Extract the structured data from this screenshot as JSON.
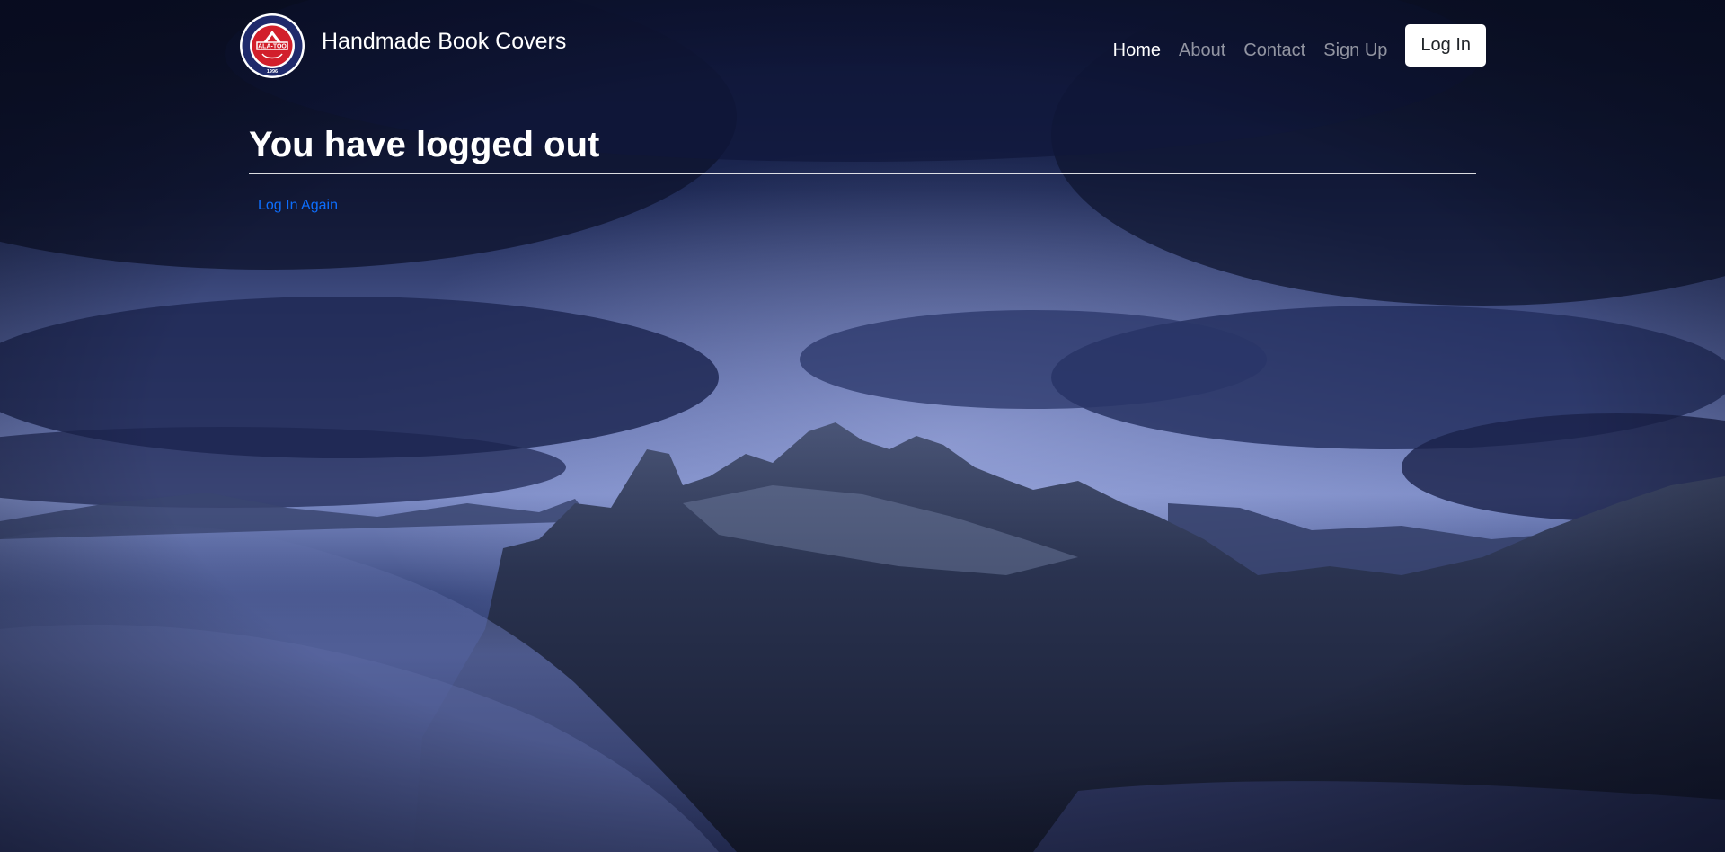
{
  "header": {
    "brand_name": "Handmade Book Covers",
    "logo": {
      "icon": "ala-too-university-seal-icon",
      "text_top": "ALA-TOO INTERNATIONAL UNIVERSITY",
      "text_center": "ALA-TOO",
      "year": "1996"
    },
    "nav": [
      {
        "label": "Home",
        "active": true
      },
      {
        "label": "About",
        "active": false
      },
      {
        "label": "Contact",
        "active": false
      },
      {
        "label": "Sign Up",
        "active": false
      }
    ],
    "login_label": "Log In"
  },
  "main": {
    "title": "You have logged out",
    "login_again_label": "Log In Again"
  },
  "background": {
    "description_icon": "mountain-landscape-background",
    "accent_colors": [
      "#141c3a",
      "#2b3a6e",
      "#6f7fbf",
      "#0d6efd"
    ]
  }
}
